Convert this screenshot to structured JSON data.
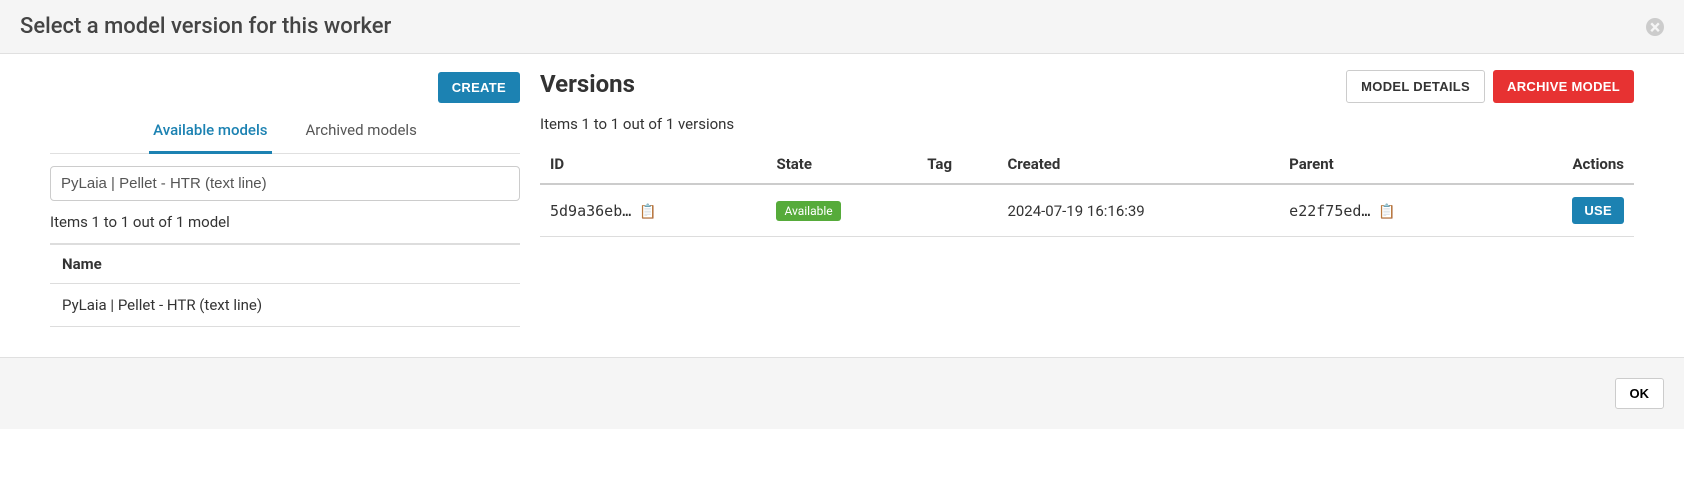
{
  "header": {
    "title": "Select a model version for this worker"
  },
  "leftPanel": {
    "createButton": "CREATE",
    "tabs": {
      "available": "Available models",
      "archived": "Archived models"
    },
    "searchValue": "PyLaia | Pellet - HTR (text line)",
    "itemsCount": "Items 1 to 1 out of 1 model",
    "tableHeader": "Name",
    "rows": [
      {
        "name": "PyLaia | Pellet - HTR (text line)"
      }
    ]
  },
  "rightPanel": {
    "title": "Versions",
    "modelDetailsButton": "MODEL DETAILS",
    "archiveButton": "ARCHIVE MODEL",
    "itemsCount": "Items 1 to 1 out of 1 versions",
    "headers": {
      "id": "ID",
      "state": "State",
      "tag": "Tag",
      "created": "Created",
      "parent": "Parent",
      "actions": "Actions"
    },
    "rows": [
      {
        "id": "5d9a36eb…",
        "state": "Available",
        "tag": "",
        "created": "2024-07-19 16:16:39",
        "parent": "e22f75ed…",
        "useButton": "USE"
      }
    ]
  },
  "footer": {
    "ok": "OK"
  }
}
